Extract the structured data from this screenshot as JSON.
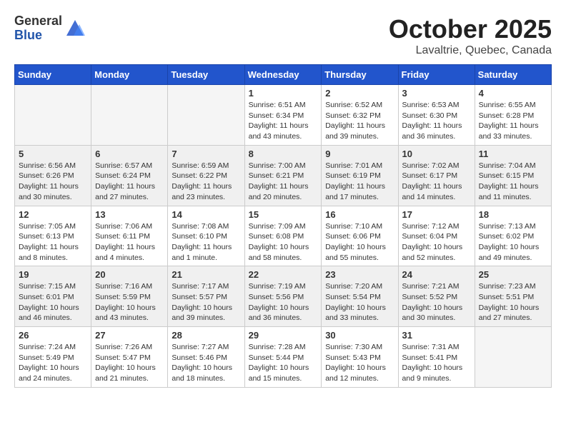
{
  "header": {
    "logo_general": "General",
    "logo_blue": "Blue",
    "month_title": "October 2025",
    "location": "Lavaltrie, Quebec, Canada"
  },
  "weekdays": [
    "Sunday",
    "Monday",
    "Tuesday",
    "Wednesday",
    "Thursday",
    "Friday",
    "Saturday"
  ],
  "weeks": [
    [
      {
        "day": "",
        "sunrise": "",
        "sunset": "",
        "daylight": "",
        "empty": true
      },
      {
        "day": "",
        "sunrise": "",
        "sunset": "",
        "daylight": "",
        "empty": true
      },
      {
        "day": "",
        "sunrise": "",
        "sunset": "",
        "daylight": "",
        "empty": true
      },
      {
        "day": "1",
        "sunrise": "Sunrise: 6:51 AM",
        "sunset": "Sunset: 6:34 PM",
        "daylight": "Daylight: 11 hours and 43 minutes."
      },
      {
        "day": "2",
        "sunrise": "Sunrise: 6:52 AM",
        "sunset": "Sunset: 6:32 PM",
        "daylight": "Daylight: 11 hours and 39 minutes."
      },
      {
        "day": "3",
        "sunrise": "Sunrise: 6:53 AM",
        "sunset": "Sunset: 6:30 PM",
        "daylight": "Daylight: 11 hours and 36 minutes."
      },
      {
        "day": "4",
        "sunrise": "Sunrise: 6:55 AM",
        "sunset": "Sunset: 6:28 PM",
        "daylight": "Daylight: 11 hours and 33 minutes."
      }
    ],
    [
      {
        "day": "5",
        "sunrise": "Sunrise: 6:56 AM",
        "sunset": "Sunset: 6:26 PM",
        "daylight": "Daylight: 11 hours and 30 minutes."
      },
      {
        "day": "6",
        "sunrise": "Sunrise: 6:57 AM",
        "sunset": "Sunset: 6:24 PM",
        "daylight": "Daylight: 11 hours and 27 minutes."
      },
      {
        "day": "7",
        "sunrise": "Sunrise: 6:59 AM",
        "sunset": "Sunset: 6:22 PM",
        "daylight": "Daylight: 11 hours and 23 minutes."
      },
      {
        "day": "8",
        "sunrise": "Sunrise: 7:00 AM",
        "sunset": "Sunset: 6:21 PM",
        "daylight": "Daylight: 11 hours and 20 minutes."
      },
      {
        "day": "9",
        "sunrise": "Sunrise: 7:01 AM",
        "sunset": "Sunset: 6:19 PM",
        "daylight": "Daylight: 11 hours and 17 minutes."
      },
      {
        "day": "10",
        "sunrise": "Sunrise: 7:02 AM",
        "sunset": "Sunset: 6:17 PM",
        "daylight": "Daylight: 11 hours and 14 minutes."
      },
      {
        "day": "11",
        "sunrise": "Sunrise: 7:04 AM",
        "sunset": "Sunset: 6:15 PM",
        "daylight": "Daylight: 11 hours and 11 minutes."
      }
    ],
    [
      {
        "day": "12",
        "sunrise": "Sunrise: 7:05 AM",
        "sunset": "Sunset: 6:13 PM",
        "daylight": "Daylight: 11 hours and 8 minutes."
      },
      {
        "day": "13",
        "sunrise": "Sunrise: 7:06 AM",
        "sunset": "Sunset: 6:11 PM",
        "daylight": "Daylight: 11 hours and 4 minutes."
      },
      {
        "day": "14",
        "sunrise": "Sunrise: 7:08 AM",
        "sunset": "Sunset: 6:10 PM",
        "daylight": "Daylight: 11 hours and 1 minute."
      },
      {
        "day": "15",
        "sunrise": "Sunrise: 7:09 AM",
        "sunset": "Sunset: 6:08 PM",
        "daylight": "Daylight: 10 hours and 58 minutes."
      },
      {
        "day": "16",
        "sunrise": "Sunrise: 7:10 AM",
        "sunset": "Sunset: 6:06 PM",
        "daylight": "Daylight: 10 hours and 55 minutes."
      },
      {
        "day": "17",
        "sunrise": "Sunrise: 7:12 AM",
        "sunset": "Sunset: 6:04 PM",
        "daylight": "Daylight: 10 hours and 52 minutes."
      },
      {
        "day": "18",
        "sunrise": "Sunrise: 7:13 AM",
        "sunset": "Sunset: 6:02 PM",
        "daylight": "Daylight: 10 hours and 49 minutes."
      }
    ],
    [
      {
        "day": "19",
        "sunrise": "Sunrise: 7:15 AM",
        "sunset": "Sunset: 6:01 PM",
        "daylight": "Daylight: 10 hours and 46 minutes."
      },
      {
        "day": "20",
        "sunrise": "Sunrise: 7:16 AM",
        "sunset": "Sunset: 5:59 PM",
        "daylight": "Daylight: 10 hours and 43 minutes."
      },
      {
        "day": "21",
        "sunrise": "Sunrise: 7:17 AM",
        "sunset": "Sunset: 5:57 PM",
        "daylight": "Daylight: 10 hours and 39 minutes."
      },
      {
        "day": "22",
        "sunrise": "Sunrise: 7:19 AM",
        "sunset": "Sunset: 5:56 PM",
        "daylight": "Daylight: 10 hours and 36 minutes."
      },
      {
        "day": "23",
        "sunrise": "Sunrise: 7:20 AM",
        "sunset": "Sunset: 5:54 PM",
        "daylight": "Daylight: 10 hours and 33 minutes."
      },
      {
        "day": "24",
        "sunrise": "Sunrise: 7:21 AM",
        "sunset": "Sunset: 5:52 PM",
        "daylight": "Daylight: 10 hours and 30 minutes."
      },
      {
        "day": "25",
        "sunrise": "Sunrise: 7:23 AM",
        "sunset": "Sunset: 5:51 PM",
        "daylight": "Daylight: 10 hours and 27 minutes."
      }
    ],
    [
      {
        "day": "26",
        "sunrise": "Sunrise: 7:24 AM",
        "sunset": "Sunset: 5:49 PM",
        "daylight": "Daylight: 10 hours and 24 minutes."
      },
      {
        "day": "27",
        "sunrise": "Sunrise: 7:26 AM",
        "sunset": "Sunset: 5:47 PM",
        "daylight": "Daylight: 10 hours and 21 minutes."
      },
      {
        "day": "28",
        "sunrise": "Sunrise: 7:27 AM",
        "sunset": "Sunset: 5:46 PM",
        "daylight": "Daylight: 10 hours and 18 minutes."
      },
      {
        "day": "29",
        "sunrise": "Sunrise: 7:28 AM",
        "sunset": "Sunset: 5:44 PM",
        "daylight": "Daylight: 10 hours and 15 minutes."
      },
      {
        "day": "30",
        "sunrise": "Sunrise: 7:30 AM",
        "sunset": "Sunset: 5:43 PM",
        "daylight": "Daylight: 10 hours and 12 minutes."
      },
      {
        "day": "31",
        "sunrise": "Sunrise: 7:31 AM",
        "sunset": "Sunset: 5:41 PM",
        "daylight": "Daylight: 10 hours and 9 minutes."
      },
      {
        "day": "",
        "sunrise": "",
        "sunset": "",
        "daylight": "",
        "empty": true
      }
    ]
  ]
}
